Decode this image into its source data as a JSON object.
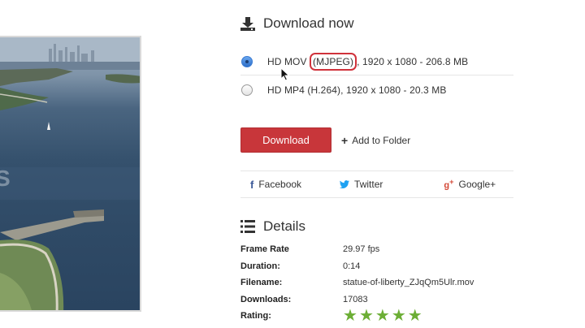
{
  "preview": {
    "overlay_text": "S"
  },
  "download": {
    "title": "Download now",
    "options": [
      {
        "format": "HD MOV",
        "codec": "(MJPEG)",
        "rest": ", 1920 x 1080 - 206.8 MB",
        "selected": true
      },
      {
        "label": "HD MP4 (H.264), 1920 x 1080 - 20.3 MB",
        "selected": false
      }
    ],
    "download_label": "Download",
    "add_folder_label": "Add to Folder"
  },
  "share": {
    "facebook": "Facebook",
    "twitter": "Twitter",
    "googleplus": "Google+"
  },
  "details": {
    "title": "Details",
    "rows": [
      {
        "key": "Frame Rate",
        "value": "29.97 fps"
      },
      {
        "key": "Duration:",
        "value": "0:14"
      },
      {
        "key": "Filename:",
        "value": "statue-of-liberty_ZJqQm5Ulr.mov"
      },
      {
        "key": "Downloads:",
        "value": "17083"
      },
      {
        "key": "Rating:",
        "value": ""
      }
    ],
    "rating": 5
  },
  "colors": {
    "primary_button": "#c8363a",
    "highlight_border": "#d0323b",
    "star": "#6cae35"
  }
}
